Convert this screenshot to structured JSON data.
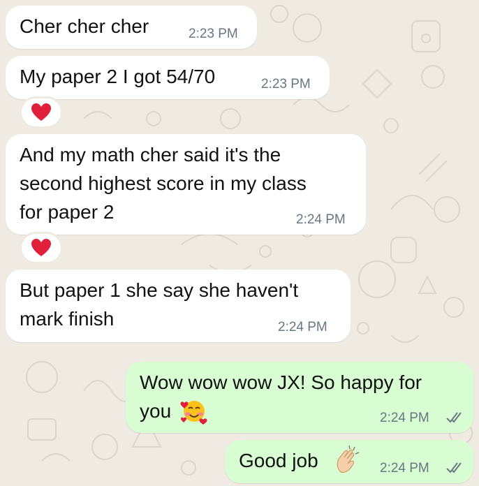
{
  "colors": {
    "chat_background": "#efeae2",
    "incoming_bubble": "#ffffff",
    "outgoing_bubble": "#d9fdd3",
    "timestamp": "#667781",
    "read_ticks": "#667781",
    "heart": "#e0203a"
  },
  "messages": [
    {
      "direction": "incoming",
      "text": "Cher cher cher",
      "time": "2:23 PM",
      "reaction": null
    },
    {
      "direction": "incoming",
      "text": "My paper 2 I got 54/70",
      "time": "2:23 PM",
      "reaction": "red-heart-icon"
    },
    {
      "direction": "incoming",
      "text": "And my math cher said it's the\nsecond highest score in my class\nfor paper 2",
      "time": "2:24 PM",
      "reaction": "red-heart-icon"
    },
    {
      "direction": "incoming",
      "text": "But paper 1 she say she haven't\nmark finish",
      "time": "2:24 PM",
      "reaction": null
    },
    {
      "direction": "outgoing",
      "text": "Wow wow wow JX! So happy for\nyou",
      "emoji": "smiling-face-with-hearts-icon",
      "time": "2:24 PM",
      "status": "read"
    },
    {
      "direction": "outgoing",
      "text": "Good job",
      "emoji": "clapping-hands-icon",
      "time": "2:24 PM",
      "status": "read"
    }
  ]
}
